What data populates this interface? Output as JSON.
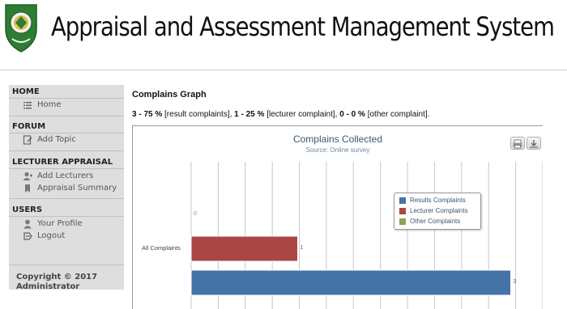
{
  "header": {
    "title": "Appraisal and Assessment Management System"
  },
  "sidebar": {
    "sections": [
      {
        "title": "HOME",
        "items": [
          {
            "label": "Home",
            "icon": "list-icon"
          }
        ]
      },
      {
        "title": "FORUM",
        "items": [
          {
            "label": "Add Topic",
            "icon": "edit-icon"
          }
        ]
      },
      {
        "title": "LECTURER APPRAISAL",
        "items": [
          {
            "label": "Add Lecturers",
            "icon": "add-user-icon"
          },
          {
            "label": "Appraisal Summary",
            "icon": "bookmark-icon"
          }
        ]
      },
      {
        "title": "USERS",
        "items": [
          {
            "label": "Your Profile",
            "icon": "user-icon"
          },
          {
            "label": "Logout",
            "icon": "logout-icon"
          }
        ]
      }
    ],
    "copyright_line1": "Copyright © 2017",
    "copyright_line2": "Administrator"
  },
  "main": {
    "title": "Complains Graph",
    "summary": [
      {
        "bold": "3 - 75 %",
        "text": " [result complaints], "
      },
      {
        "bold": "1 - 25 %",
        "text": " [lecturer complaint], "
      },
      {
        "bold": "0 - 0 %",
        "text": " [other complaint]."
      }
    ]
  },
  "chart_data": {
    "type": "bar",
    "orientation": "horizontal",
    "title": "Complains Collected",
    "subtitle": "Source: Online survey",
    "categories": [
      "All Complaints"
    ],
    "series": [
      {
        "name": "Results Complaints",
        "values": [
          3
        ],
        "color": "#4572a7"
      },
      {
        "name": "Lecturer Complaints",
        "values": [
          1
        ],
        "color": "#aa4643"
      },
      {
        "name": "Other Complaints",
        "values": [
          0
        ],
        "color": "#89a54e"
      }
    ],
    "grid": true,
    "legend_position": "right"
  }
}
